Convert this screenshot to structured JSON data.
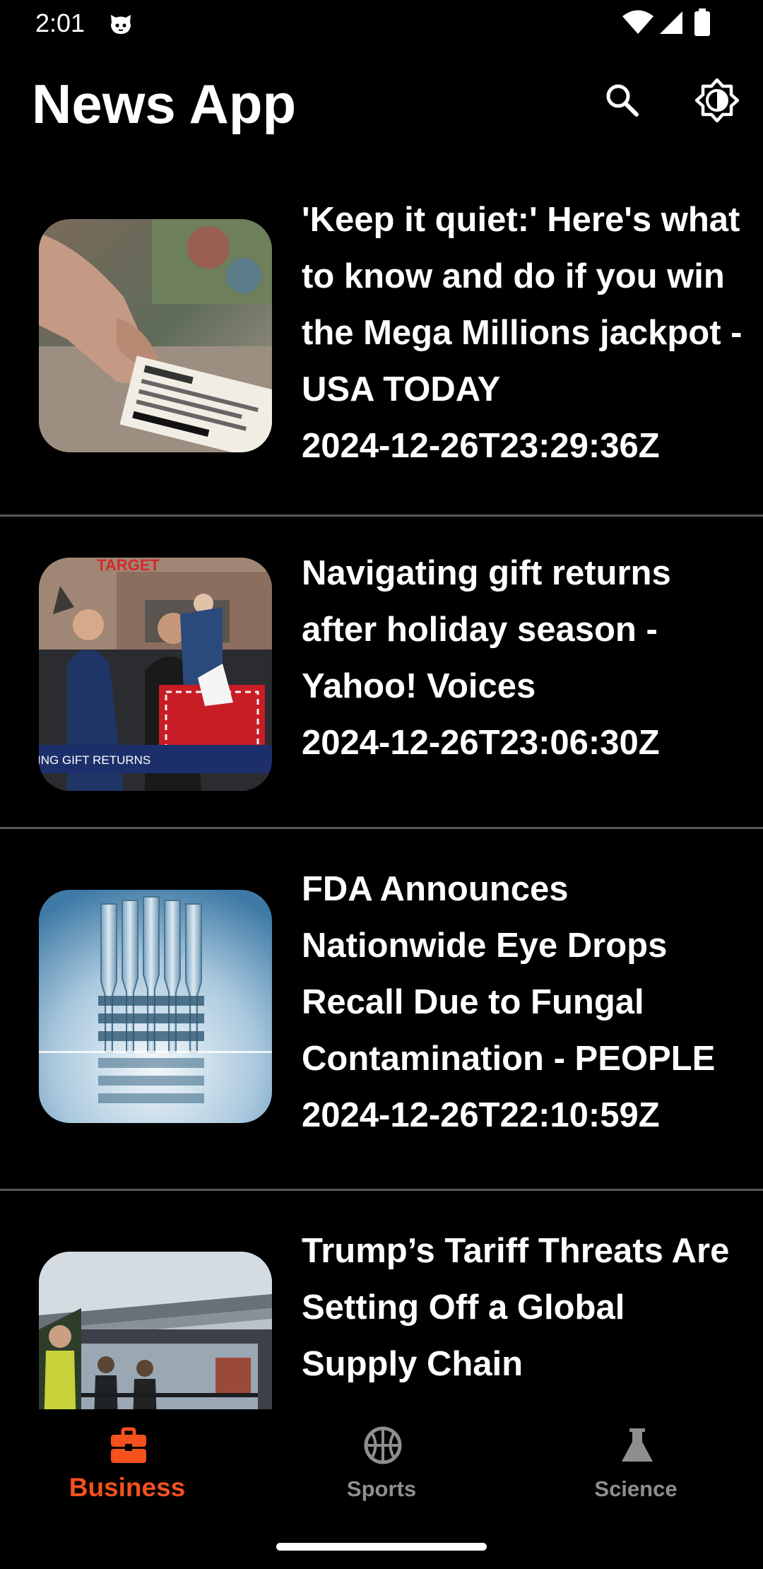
{
  "status_bar": {
    "time": "2:01"
  },
  "app_bar": {
    "title": "News App",
    "icons": [
      "search-icon",
      "brightness-icon"
    ]
  },
  "articles": [
    {
      "title": "'Keep it quiet:' Here's what to know and do if you win the Mega Millions jackpot - USA TODAY",
      "published_at": "2024-12-26T23:29:36Z",
      "thumbnail": "lottery-ticket-photo"
    },
    {
      "title": "Navigating gift returns after holiday season - Yahoo! Voices",
      "published_at": "2024-12-26T23:06:30Z",
      "thumbnail": "gift-returns-news-photo",
      "thumbnail_caption": "ING GIFT RETURNS",
      "thumbnail_sign": "TARGET"
    },
    {
      "title": "FDA Announces Nationwide Eye Drops Recall Due to Fungal Contamination - PEOPLE",
      "published_at": "2024-12-26T22:10:59Z",
      "thumbnail": "eye-drop-vials-photo"
    },
    {
      "title": "Trump’s Tariff Threats Are Setting Off a Global Supply Chain",
      "published_at": "",
      "thumbnail": "shipping-port-photo"
    }
  ],
  "bottom_nav": {
    "selected": "Business",
    "items": [
      {
        "label": "Business",
        "icon": "briefcase-icon"
      },
      {
        "label": "Sports",
        "icon": "basketball-icon"
      },
      {
        "label": "Science",
        "icon": "flask-icon"
      }
    ]
  },
  "colors": {
    "background": "#000000",
    "accent": "#f4511e",
    "inactive": "#8e8e8e",
    "divider": "#5a5a5a"
  }
}
